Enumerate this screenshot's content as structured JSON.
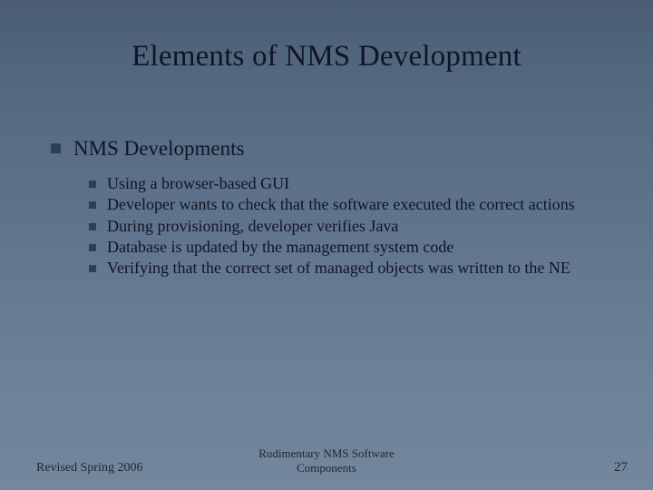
{
  "slide": {
    "title": "Elements of NMS Development",
    "heading": "NMS Developments",
    "bullets": [
      "Using a browser-based GUI",
      "Developer wants to check that the software executed the correct actions",
      "During provisioning, developer verifies Java",
      "Database is updated by the management system code",
      "Verifying that the correct set of managed objects was written to the NE"
    ],
    "footer": {
      "left": "Revised Spring 2006",
      "center_line1": "Rudimentary NMS Software",
      "center_line2": "Components",
      "page": "27"
    }
  }
}
